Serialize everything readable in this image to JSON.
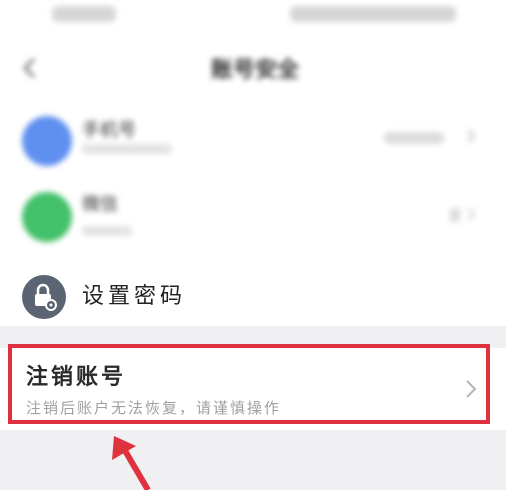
{
  "status_bar": {
    "time": "",
    "right": ""
  },
  "header": {
    "title": "账号安全"
  },
  "accounts": [
    {
      "name": "手机号",
      "value": "",
      "accent": "#5f8ff0"
    },
    {
      "name": "微信",
      "value": "",
      "accent": "#43c06a"
    }
  ],
  "password": {
    "label": "设置密码"
  },
  "cancel_account": {
    "title": "注销账号",
    "subtitle": "注销后账户无法恢复，请谨慎操作",
    "highlight_color": "#e0323e"
  }
}
